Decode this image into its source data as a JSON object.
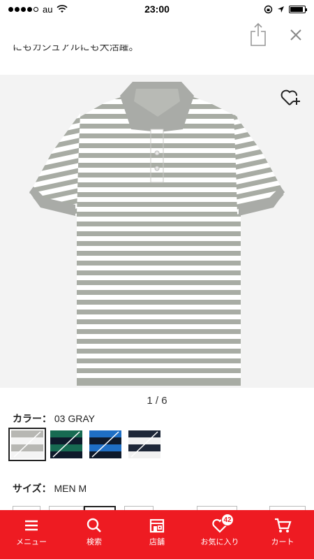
{
  "status_bar": {
    "carrier": "au",
    "time": "23:00",
    "battery_level": 0.9
  },
  "header": {
    "share_icon": "share-icon",
    "close_icon": "close-icon",
    "cut_text": "にもカジュアルにも大活躍。"
  },
  "product": {
    "image_alt": "striped polo shirt",
    "pager": "1 / 6",
    "color_label": "カラー：",
    "color_value": "03 GRAY",
    "size_label": "サイズ：",
    "size_value": "MEN M",
    "swatches": [
      {
        "name": "gray",
        "colors": [
          "#b7b7b3",
          "#f4f4f4"
        ]
      },
      {
        "name": "green",
        "colors": [
          "#176b52",
          "#0e1a2b"
        ]
      },
      {
        "name": "blue",
        "colors": [
          "#1f6fc4",
          "#0e1a2b"
        ]
      },
      {
        "name": "navy",
        "colors": [
          "#1e2738",
          "#f1f1f1"
        ]
      }
    ],
    "selected_swatch": 0
  },
  "tabs": [
    {
      "label": "メニュー",
      "icon": "menu-icon"
    },
    {
      "label": "検索",
      "icon": "search-icon"
    },
    {
      "label": "店舗",
      "icon": "store-icon"
    },
    {
      "label": "お気に入り",
      "icon": "heart-icon",
      "badge": "42"
    },
    {
      "label": "カート",
      "icon": "cart-icon"
    }
  ],
  "colors": {
    "brand_red": "#ee1b22"
  }
}
